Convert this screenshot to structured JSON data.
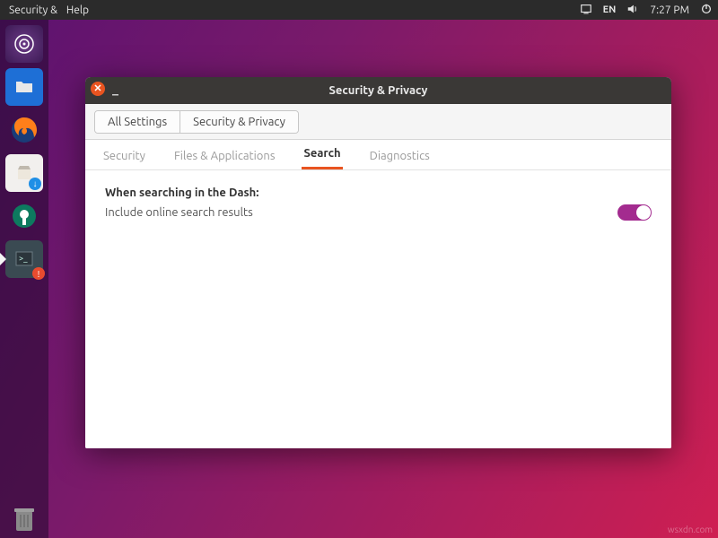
{
  "topbar": {
    "menu1": "Security &",
    "menu2": "Help",
    "lang": "EN",
    "time": "7:27 PM"
  },
  "launcher": {
    "items": [
      {
        "name": "dash-icon"
      },
      {
        "name": "files-icon"
      },
      {
        "name": "firefox-icon"
      },
      {
        "name": "software-icon"
      },
      {
        "name": "settings-icon"
      },
      {
        "name": "terminal-icon"
      }
    ],
    "trash": "trash-icon"
  },
  "window": {
    "title": "Security & Privacy",
    "breadcrumb": [
      "All Settings",
      "Security & Privacy"
    ],
    "tabs": [
      {
        "label": "Security",
        "active": false
      },
      {
        "label": "Files & Applications",
        "active": false
      },
      {
        "label": "Search",
        "active": true
      },
      {
        "label": "Diagnostics",
        "active": false
      }
    ],
    "search_panel": {
      "heading": "When searching in the Dash:",
      "option_label": "Include online search results",
      "option_value": true
    }
  },
  "watermark": "wsxdn.com"
}
